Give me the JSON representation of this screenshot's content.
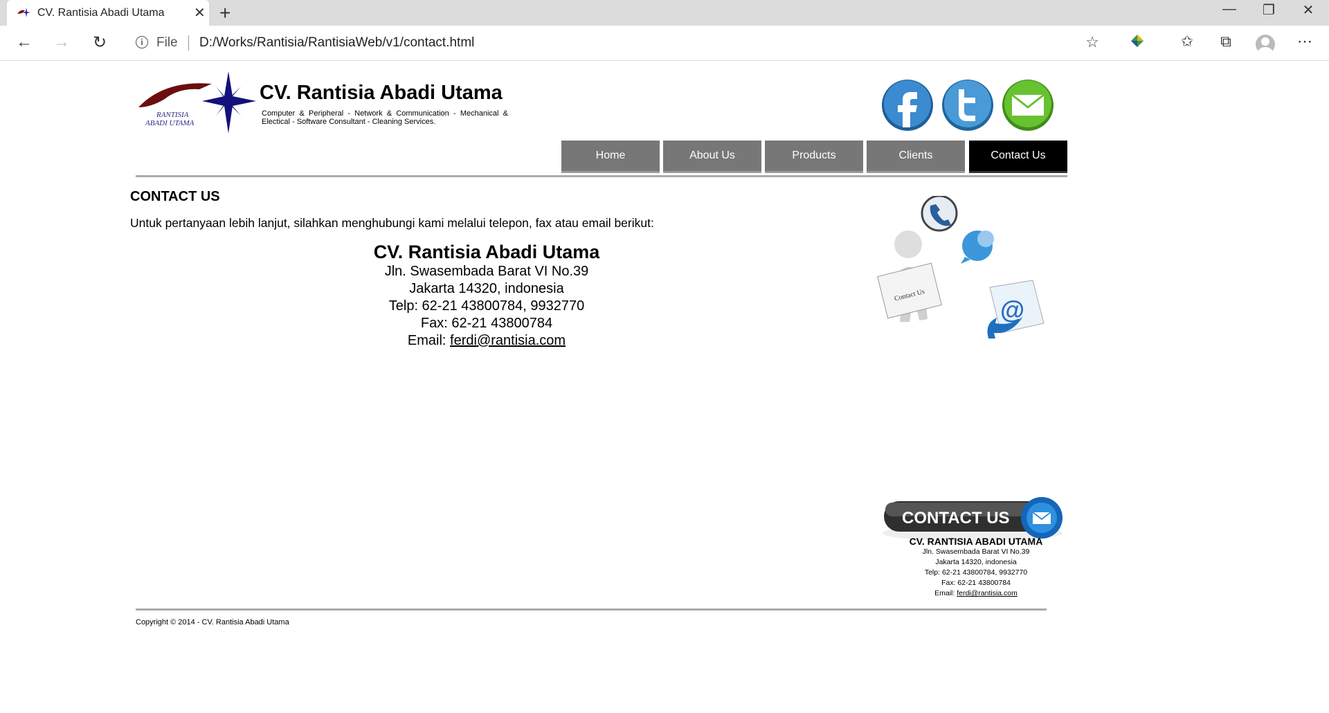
{
  "browser": {
    "tab_title": "CV. Rantisia Abadi Utama",
    "address_prefix": "File",
    "url": "D:/Works/Rantisia/RantisiaWeb/v1/contact.html"
  },
  "header": {
    "logo_text_1": "RANTISIA",
    "logo_text_2": "ABADI UTAMA",
    "title": "CV. Rantisia Abadi Utama",
    "tagline": "Computer & Peripheral - Network & Communication - Mechanical & Electical - Software Consultant - Cleaning Services."
  },
  "social": [
    {
      "name": "facebook",
      "color": "#2a7fc5"
    },
    {
      "name": "twitter",
      "color": "#3b8fd0"
    },
    {
      "name": "email",
      "color": "#5cb82a"
    }
  ],
  "menu": {
    "items": [
      {
        "label": "Home"
      },
      {
        "label": "About Us"
      },
      {
        "label": "Products"
      },
      {
        "label": "Clients"
      },
      {
        "label": "Contact Us",
        "active": true
      }
    ]
  },
  "content": {
    "heading": "CONTACT US",
    "intro": "Untuk pertanyaan lebih lanjut, silahkan menghubungi kami melalui telepon, fax atau email berikut:",
    "company": "CV. Rantisia Abadi Utama",
    "street": "Jln. Swasembada Barat VI No.39",
    "city": "Jakarta 14320, indonesia",
    "telp": "Telp: 62-21 43800784, 9932770",
    "fax": "Fax: 62-21 43800784",
    "email_label": "Email: ",
    "email": "ferdi@rantisia.com",
    "illustration_sign": "Contact Us"
  },
  "footer_badge": {
    "label": "CONTACT US",
    "company": "CV. RANTISIA ABADI UTAMA",
    "street": "Jln. Swasembada Barat VI No.39",
    "city": "Jakarta 14320, indonesia",
    "telp": "Telp: 62-21 43800784, 9932770",
    "fax": "Fax: 62-21 43800784",
    "email_label": "Email: ",
    "email": "ferdi@rantisia.com"
  },
  "copyright": "Copyright © 2014 - CV. Rantisia Abadi Utama"
}
